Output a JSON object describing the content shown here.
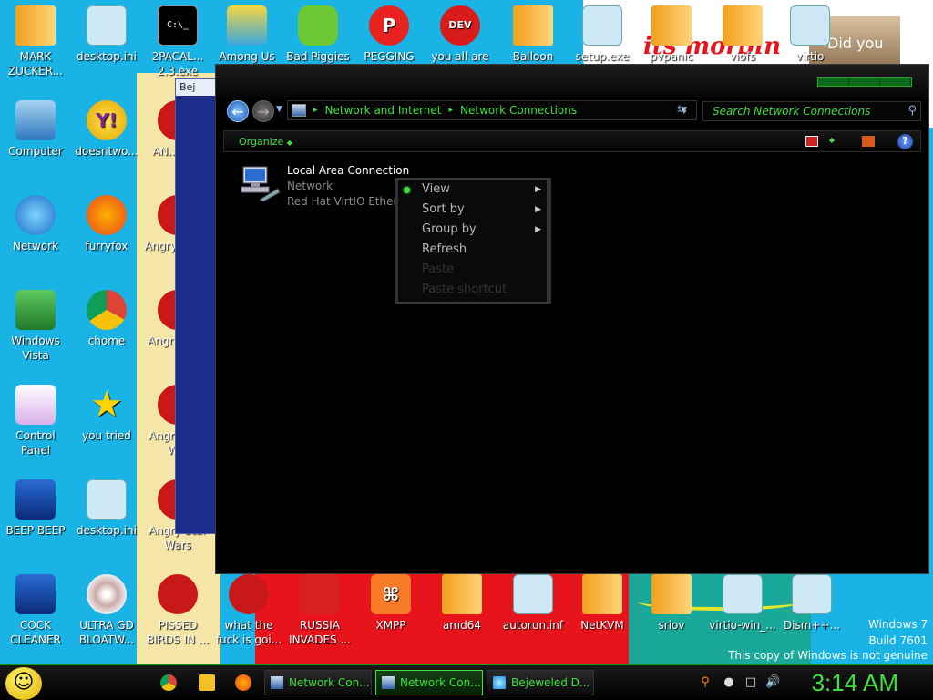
{
  "desktop": {
    "wall_text": "its morbin",
    "did_you": "Did you",
    "icons": [
      {
        "label": "MARK ZUCKER...",
        "kind": "folder"
      },
      {
        "label": "desktop.ini",
        "kind": "doc"
      },
      {
        "label": "2PACAL... 2.3.exe",
        "kind": "cmd"
      },
      {
        "label": "Among Us",
        "kind": "among"
      },
      {
        "label": "Bad Piggies",
        "kind": "green"
      },
      {
        "label": "PEGGING",
        "kind": "peg"
      },
      {
        "label": "you all are",
        "kind": "devcpp"
      },
      {
        "label": "Balloon",
        "kind": "folder"
      },
      {
        "label": "setup.exe",
        "kind": "doc"
      },
      {
        "label": "pvpanic",
        "kind": "folder"
      },
      {
        "label": "viofs",
        "kind": "folder"
      },
      {
        "label": "virtio",
        "kind": "doc"
      },
      {
        "label": "Computer",
        "kind": "computer"
      },
      {
        "label": "doesntwo...",
        "kind": "yahoo"
      },
      {
        "label": "AN... Bi...",
        "kind": "bird"
      },
      {
        "label": "Network",
        "kind": "globe"
      },
      {
        "label": "furryfox",
        "kind": "fox"
      },
      {
        "label": "Angry Sea...",
        "kind": "bird"
      },
      {
        "label": "Windows Vista",
        "kind": "bin"
      },
      {
        "label": "chome",
        "kind": "chrome"
      },
      {
        "label": "Angry Sp...",
        "kind": "bird"
      },
      {
        "label": "Control Panel",
        "kind": "cpanel"
      },
      {
        "label": "you tried",
        "kind": "star"
      },
      {
        "label": "Angry Star W...",
        "kind": "bird"
      },
      {
        "label": "BEEP BEEP",
        "kind": "blue"
      },
      {
        "label": "desktop.ini",
        "kind": "doc"
      },
      {
        "label": "Angry Star Wars",
        "kind": "bird"
      },
      {
        "label": "COCK CLEANER",
        "kind": "blue"
      },
      {
        "label": "ULTRA GD BLOATW...",
        "kind": "cd"
      },
      {
        "label": "PISSED BIRDS IN ...",
        "kind": "bird"
      },
      {
        "label": "what the fuck is goi...",
        "kind": "bird"
      },
      {
        "label": "RUSSIA INVADES ...",
        "kind": "red"
      },
      {
        "label": "XMPP",
        "kind": "xampp"
      },
      {
        "label": "amd64",
        "kind": "folder"
      },
      {
        "label": "autorun.inf",
        "kind": "doc"
      },
      {
        "label": "NetKVM",
        "kind": "folder"
      },
      {
        "label": "sriov",
        "kind": "folder"
      },
      {
        "label": "virtio-win_...",
        "kind": "doc"
      },
      {
        "label": "Dism++...",
        "kind": "doc"
      }
    ]
  },
  "background_window": {
    "title": "Bej"
  },
  "explorer": {
    "breadcrumb": [
      "Network and Internet",
      "Network Connections"
    ],
    "search_placeholder": "Search Network Connections",
    "organize_label": "Organize",
    "connection": {
      "name": "Local Area Connection",
      "status": "Network",
      "adapter": "Red Hat VirtIO Ether"
    }
  },
  "context_menu": {
    "items": [
      {
        "label": "View",
        "submenu": true,
        "enabled": true,
        "selected": true
      },
      {
        "label": "Sort by",
        "submenu": true,
        "enabled": true
      },
      {
        "label": "Group by",
        "submenu": true,
        "enabled": true
      },
      {
        "label": "Refresh",
        "submenu": false,
        "enabled": true
      },
      {
        "label": "Paste",
        "submenu": false,
        "enabled": false
      },
      {
        "label": "Paste shortcut",
        "submenu": false,
        "enabled": false
      }
    ]
  },
  "taskbar": {
    "buttons": [
      {
        "label": "Network Con...",
        "active": false
      },
      {
        "label": "Network Con...",
        "active": true
      },
      {
        "label": "Bejeweled D...",
        "active": false
      }
    ],
    "clock": "3:14 AM"
  },
  "watermark": {
    "line1": "Windows 7",
    "line2": "Build 7601",
    "line3": "This copy of Windows is not genuine"
  },
  "colors": {
    "accent": "#3fe03f",
    "desktop": "#19b3e6"
  }
}
